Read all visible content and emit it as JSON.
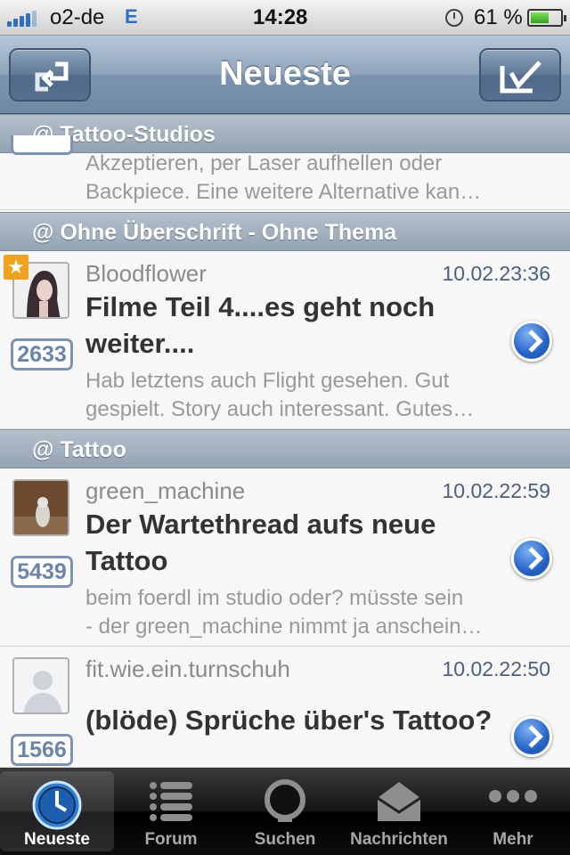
{
  "status_bar": {
    "carrier": "o2-de",
    "network": "E",
    "time": "14:28",
    "battery_percent": "61 %",
    "battery_level": 0.61
  },
  "nav": {
    "title": "Neueste",
    "left_icon": "refresh-arrows-icon",
    "right_icon": "checkmark-icon"
  },
  "sections": [
    {
      "header": "@ Tattoo-Studios",
      "items": [
        {
          "snippet_lines": [
            "Akzeptieren, per Laser aufhellen oder",
            "Backpiece. Eine weitere Alternative kan…"
          ]
        }
      ]
    },
    {
      "header": "@ Ohne Überschrift - Ohne Thema",
      "items": [
        {
          "author": "Bloodflower",
          "date": "10.02.23:36",
          "title": "Filme Teil 4....es geht noch weiter....",
          "count": "2633",
          "snippet_lines": [
            "Hab letztens auch Flight gesehen. Gut",
            "gespielt. Story auch interessant. Gutes…"
          ],
          "starred": true
        }
      ]
    },
    {
      "header": "@ Tattoo",
      "items": [
        {
          "author": "green_machine",
          "date": "10.02.22:59",
          "title": "Der Wartethread aufs neue Tattoo",
          "count": "5439",
          "snippet_lines": [
            " beim foerdl im studio oder?  müsste sein",
            "- der green_machine nimmt ja anschein…"
          ]
        },
        {
          "author": "fit.wie.ein.turnschuh",
          "date": "10.02.22:50",
          "title": "(blöde) Sprüche über's Tattoo?",
          "count": "1566"
        }
      ]
    }
  ],
  "tabs": [
    {
      "label": "Neueste",
      "icon": "clock-icon",
      "active": true
    },
    {
      "label": "Forum",
      "icon": "list-icon",
      "active": false
    },
    {
      "label": "Suchen",
      "icon": "search-icon",
      "active": false
    },
    {
      "label": "Nachrichten",
      "icon": "envelope-icon",
      "active": false
    },
    {
      "label": "Mehr",
      "icon": "more-dots-icon",
      "active": false
    }
  ],
  "colors": {
    "nav_bar": "#7c94af",
    "section_header": "#a3b1c0",
    "date_text": "#4a5f82",
    "count_badge": "#6a85ad",
    "star_badge": "#f0a11e"
  }
}
